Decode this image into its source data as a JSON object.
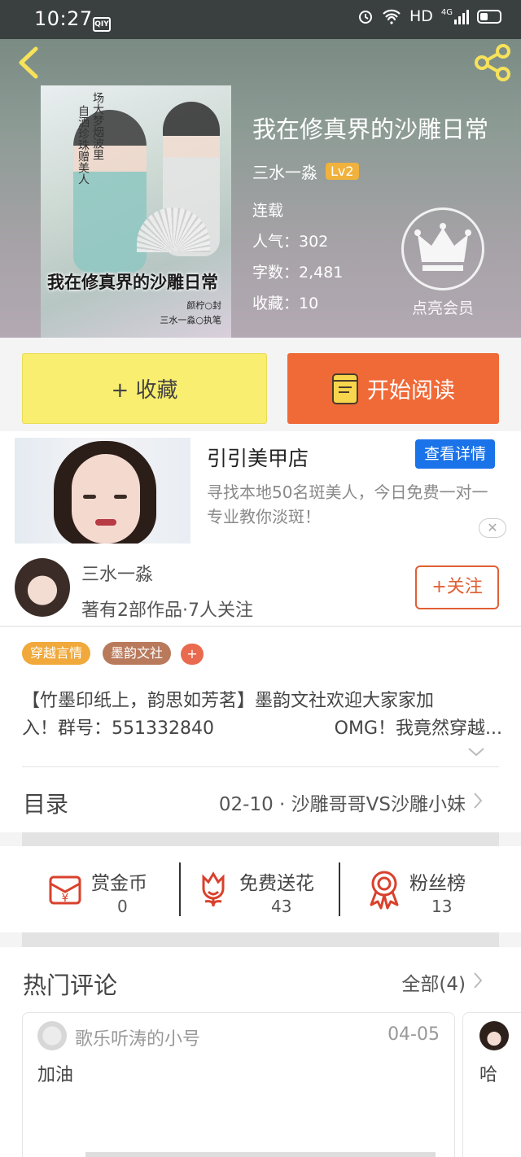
{
  "status_bar": {
    "time": "10:27",
    "app_badge": "QIY",
    "hd": "HD",
    "network": "4G"
  },
  "book": {
    "title": "我在修真界的沙雕日常",
    "author": "三水一淼",
    "level": "Lv2",
    "status": "连载",
    "popularity": "人气：302",
    "word_count": "字数：2,481",
    "favorites": "收藏：10",
    "vip_label": "点亮会员"
  },
  "cover": {
    "title": "我在修真界的沙雕日常",
    "vertical_text_1": "场大梦烟波里",
    "vertical_text_2": "自洒珍珠赠美人",
    "sig_1": "颜柠○封",
    "sig_2": "三水一淼○执笔"
  },
  "actions": {
    "collect": "+ 收藏",
    "read": "开始阅读"
  },
  "ad": {
    "title": "引引美甲店",
    "detail_button": "查看详情",
    "desc": "寻找本地50名斑美人，今日免费一对一专业教你淡斑！",
    "close": "✕"
  },
  "author_info": {
    "name": "三水一淼",
    "summary": "著有2部作品·7人关注",
    "follow": "+关注"
  },
  "tags": [
    {
      "label": "穿越言情",
      "color": "#f0a93a"
    },
    {
      "label": "墨韵文社",
      "color": "#b97a5c"
    }
  ],
  "tag_more": "+",
  "intro": {
    "line1": "【竹墨印纸上，韵思如芳茗】墨韵文社欢迎大家家加",
    "line2_left": "入！群号：551332840",
    "line2_right": "OMG！我竟然穿越..."
  },
  "catalog": {
    "label": "目录",
    "latest": "02-10 · 沙雕哥哥VS沙雕小妹"
  },
  "stats": [
    {
      "label": "赏金币",
      "value": "0",
      "icon": "reward-coin-icon"
    },
    {
      "label": "免费送花",
      "value": "43",
      "icon": "flower-icon"
    },
    {
      "label": "粉丝榜",
      "value": "13",
      "icon": "fan-rank-icon"
    }
  ],
  "comments": {
    "title": "热门评论",
    "all": "全部(4)",
    "items": [
      {
        "user": "歌乐听涛的小号",
        "date": "04-05",
        "text": "加油"
      },
      {
        "user": "",
        "date": "",
        "text": "哈"
      }
    ]
  },
  "colors": {
    "accent": "#f06a38",
    "collect": "#f9ee6f",
    "ad_button": "#1a73e8",
    "icon_red": "#d9412c"
  }
}
